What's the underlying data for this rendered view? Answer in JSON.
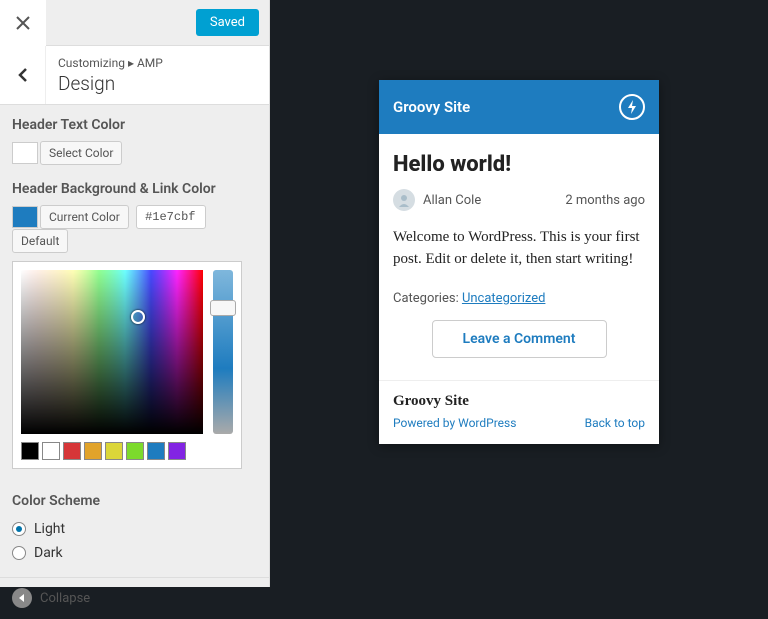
{
  "topbar": {
    "saved": "Saved"
  },
  "breadcrumb": {
    "root": "Customizing",
    "separator": "▸",
    "parent": "AMP",
    "title": "Design"
  },
  "headerText": {
    "label": "Header Text Color",
    "select": "Select Color"
  },
  "headerBg": {
    "label": "Header Background & Link Color",
    "current": "Current Color",
    "hex": "#1e7cbf",
    "default": "Default"
  },
  "palette": [
    "#000000",
    "#ffffff",
    "#d63638",
    "#e1a32a",
    "#dbd639",
    "#7cda2c",
    "#1e7cbf",
    "#8224e3"
  ],
  "scheme": {
    "label": "Color Scheme",
    "options": [
      {
        "label": "Light",
        "checked": true
      },
      {
        "label": "Dark",
        "checked": false
      }
    ]
  },
  "collapse": "Collapse",
  "preview": {
    "siteTitle": "Groovy Site",
    "post": {
      "title": "Hello world!",
      "author": "Allan Cole",
      "time": "2 months ago",
      "body": "Welcome to WordPress. This is your first post. Edit or delete it, then start writing!",
      "catLabel": "Categories: ",
      "catLink": "Uncategorized",
      "commentBtn": "Leave a Comment"
    },
    "footer": {
      "title": "Groovy Site",
      "powered": "Powered by WordPress",
      "backTop": "Back to top"
    }
  }
}
